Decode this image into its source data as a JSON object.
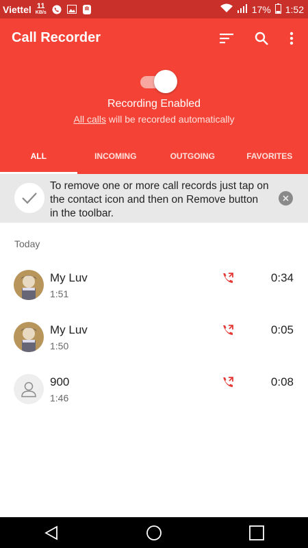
{
  "status": {
    "carrier": "Viettel",
    "speed_value": "11",
    "speed_unit": "KB/s",
    "battery": "17%",
    "time": "1:52"
  },
  "header": {
    "title": "Call Recorder"
  },
  "recording": {
    "state": "Recording Enabled",
    "desc_link": "All calls",
    "desc_rest": " will be recorded automatically"
  },
  "tabs": [
    {
      "label": "ALL"
    },
    {
      "label": "INCOMING"
    },
    {
      "label": "OUTGOING"
    },
    {
      "label": "FAVORITES"
    }
  ],
  "tip": {
    "text": "To remove one or more call records just tap on the contact icon and then on Remove button in the toolbar."
  },
  "list": {
    "section": "Today",
    "items": [
      {
        "name": "My Luv",
        "time": "1:51",
        "duration": "0:34"
      },
      {
        "name": "My Luv",
        "time": "1:50",
        "duration": "0:05"
      },
      {
        "name": "900",
        "time": "1:46",
        "duration": "0:08"
      }
    ]
  },
  "colors": {
    "primary": "#f44336",
    "status_bar": "#c9302a",
    "call_icon": "#e53935"
  }
}
